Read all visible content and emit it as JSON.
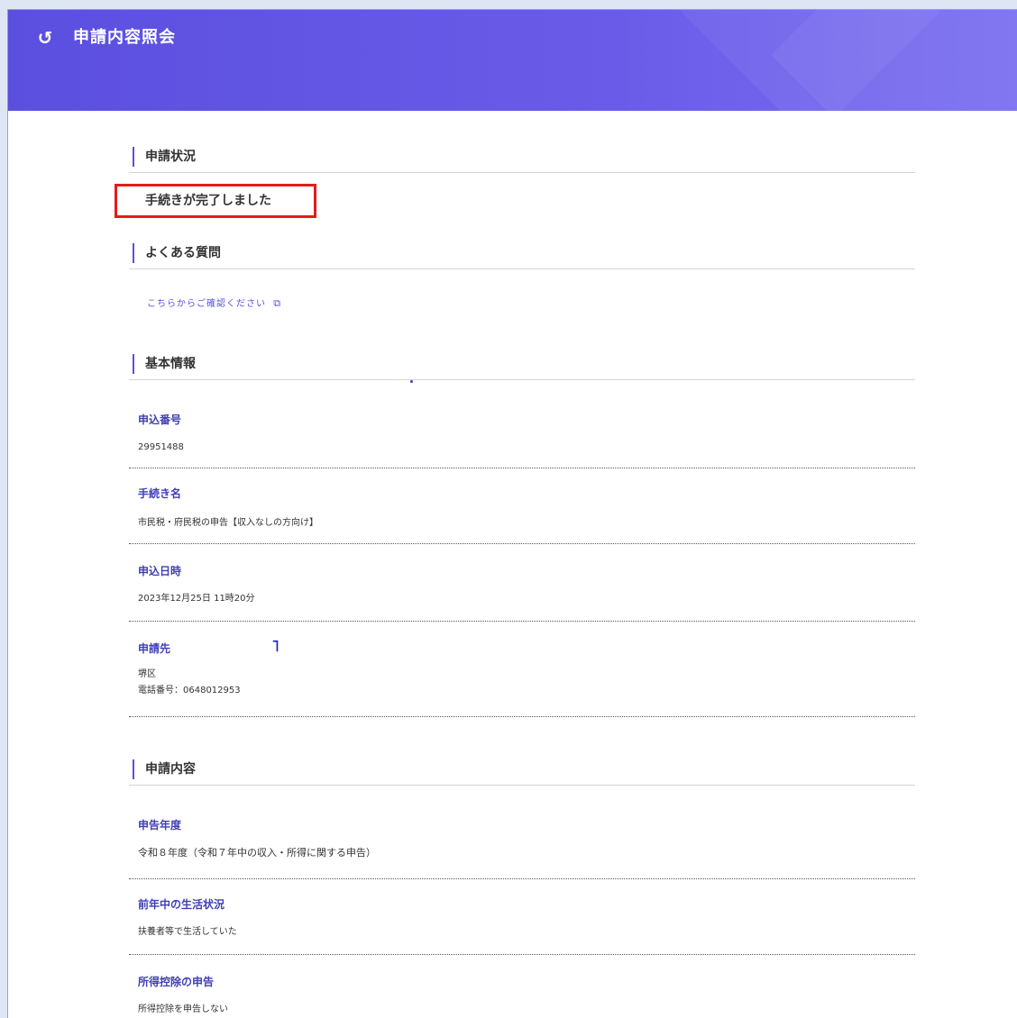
{
  "header": {
    "back_icon": "back-arrow-icon",
    "title": "申請内容照会"
  },
  "status_section": {
    "heading": "申請状況",
    "status_text": "手続きが完了しました"
  },
  "faq_section": {
    "heading": "よくある質問",
    "link_text": "こちらからご確認ください",
    "link_icon": "external-link-icon"
  },
  "basic_info": {
    "heading": "基本情報",
    "fields": [
      {
        "label": "申込番号",
        "value": "29951488"
      },
      {
        "label": "手続き名",
        "value": "市民税・府民税の申告【収入なしの方向け】"
      },
      {
        "label": "申込日時",
        "value": "2023年12月25日 11時20分"
      },
      {
        "label": "申請先",
        "value": "堺区",
        "value2": "電話番号：0648012953"
      }
    ]
  },
  "application_content": {
    "heading": "申請内容",
    "fields": [
      {
        "label": "申告年度",
        "value": "令和８年度（令和７年中の収入・所得に関する申告）"
      },
      {
        "label": "前年中の生活状況",
        "value": "扶養者等で生活していた"
      },
      {
        "label": "所得控除の申告",
        "value": "所得控除を申告しない"
      }
    ]
  },
  "colors": {
    "header_bg": "#5b4fe0",
    "accent": "#5b4fe0",
    "status_highlight_border": "#e51b1b"
  }
}
